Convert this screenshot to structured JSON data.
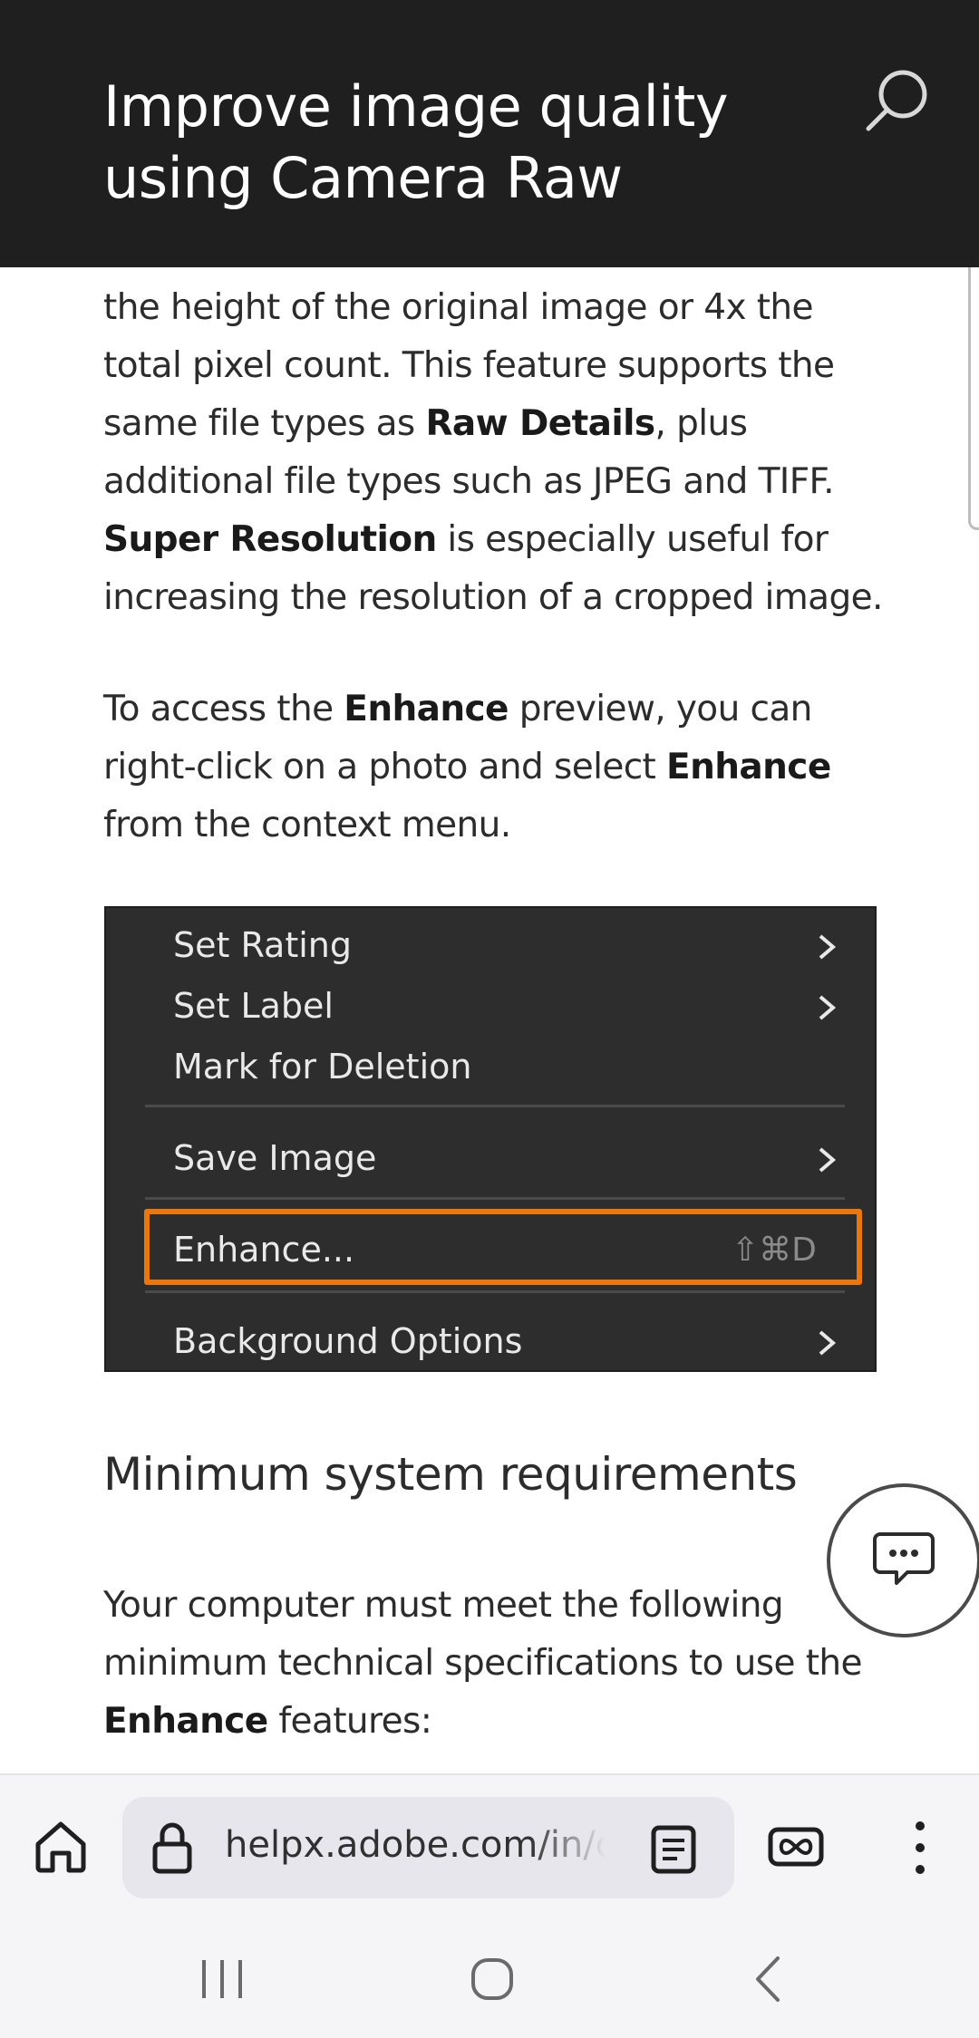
{
  "header": {
    "title": "Improve image quality using Camera Raw",
    "search_icon": "search-icon"
  },
  "article": {
    "para1": {
      "t1": "the height of the original image or 4x the total pixel count. This feature supports the same file types as ",
      "b1": "Raw Details",
      "t2": ", plus additional file types such as JPEG and TIFF. ",
      "b2": "Super Resolution",
      "t3": " is especially useful for increasing the resolution of a cropped image."
    },
    "para2": {
      "t1": "To access the ",
      "b1": "Enhance",
      "t2": " preview, you can right-click on a photo and select ",
      "b2": "Enhance",
      "t3": " from the context menu."
    },
    "figure": {
      "items": [
        {
          "label": "Set Rating",
          "submenu": true
        },
        {
          "label": "Set Label",
          "submenu": true
        },
        {
          "label": "Mark for Deletion",
          "submenu": false
        },
        {
          "label": "Save Image",
          "submenu": true
        },
        {
          "label": "Enhance...",
          "shortcut": "⇧⌘D",
          "highlight": "#e8770f"
        },
        {
          "label": "Background Options",
          "submenu": true
        }
      ]
    },
    "section_heading": "Minimum system requirements",
    "para3": {
      "t1": "Your computer must meet the following minimum technical specifications to use the ",
      "b1": "Enhance",
      "t2": " features:"
    }
  },
  "chat": {
    "icon": "chat-bubble-icon"
  },
  "browser": {
    "url": "helpx.adobe.com/in/camera-raw/using/enhance.html",
    "icons": [
      "home-icon",
      "lock-icon",
      "reader-mode-icon",
      "incognito-icon",
      "more-vert-icon"
    ]
  },
  "system_nav": {
    "icons": [
      "recent-apps-icon",
      "home-circle-icon",
      "back-icon"
    ]
  },
  "colors": {
    "header_bg": "#1f1f1f",
    "menu_bg": "#2d2d2d",
    "highlight": "#e8770f"
  }
}
